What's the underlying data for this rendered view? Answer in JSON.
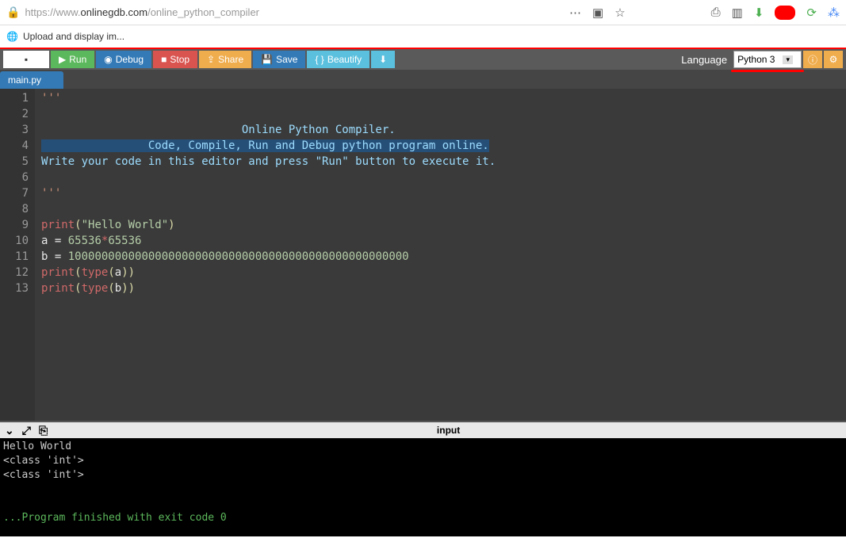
{
  "browser": {
    "url_pre": "https://www.",
    "url_host": "onlinegdb.com",
    "url_path": "/online_python_compiler",
    "bookmark": "Upload and display im..."
  },
  "toolbar": {
    "run": "Run",
    "debug": "Debug",
    "stop": "Stop",
    "share": "Share",
    "save": "Save",
    "beautify": "Beautify",
    "language_label": "Language",
    "language_value": "Python 3"
  },
  "tabs": {
    "active": "main.py"
  },
  "code": {
    "l1": "'''",
    "l2": "",
    "l3": "                              Online Python Compiler.",
    "l4_a": "                Code, Compile, Run and Debug python program online.",
    "l5": "Write your code in this editor and press \"Run\" button to execute it.",
    "l6": "",
    "l7": "'''",
    "l8": "",
    "l9_print": "print",
    "l9_str": "\"Hello World\"",
    "l10_num1": "65536",
    "l10_num2": "65536",
    "l11_num": "100000000000000000000000000000000000000000000000000",
    "l12_var": "a",
    "l13_var": "b",
    "ident_a": "a",
    "ident_b": "b",
    "eq": " = ",
    "star": "*",
    "type": "type"
  },
  "gutter": [
    "1",
    "2",
    "3",
    "4",
    "5",
    "6",
    "7",
    "8",
    "9",
    "10",
    "11",
    "12",
    "13"
  ],
  "console_bar": {
    "title": "input"
  },
  "console": {
    "l1": "Hello World",
    "l2": "<class 'int'>",
    "l3": "<class 'int'>",
    "l5": "...Program finished with exit code 0"
  }
}
